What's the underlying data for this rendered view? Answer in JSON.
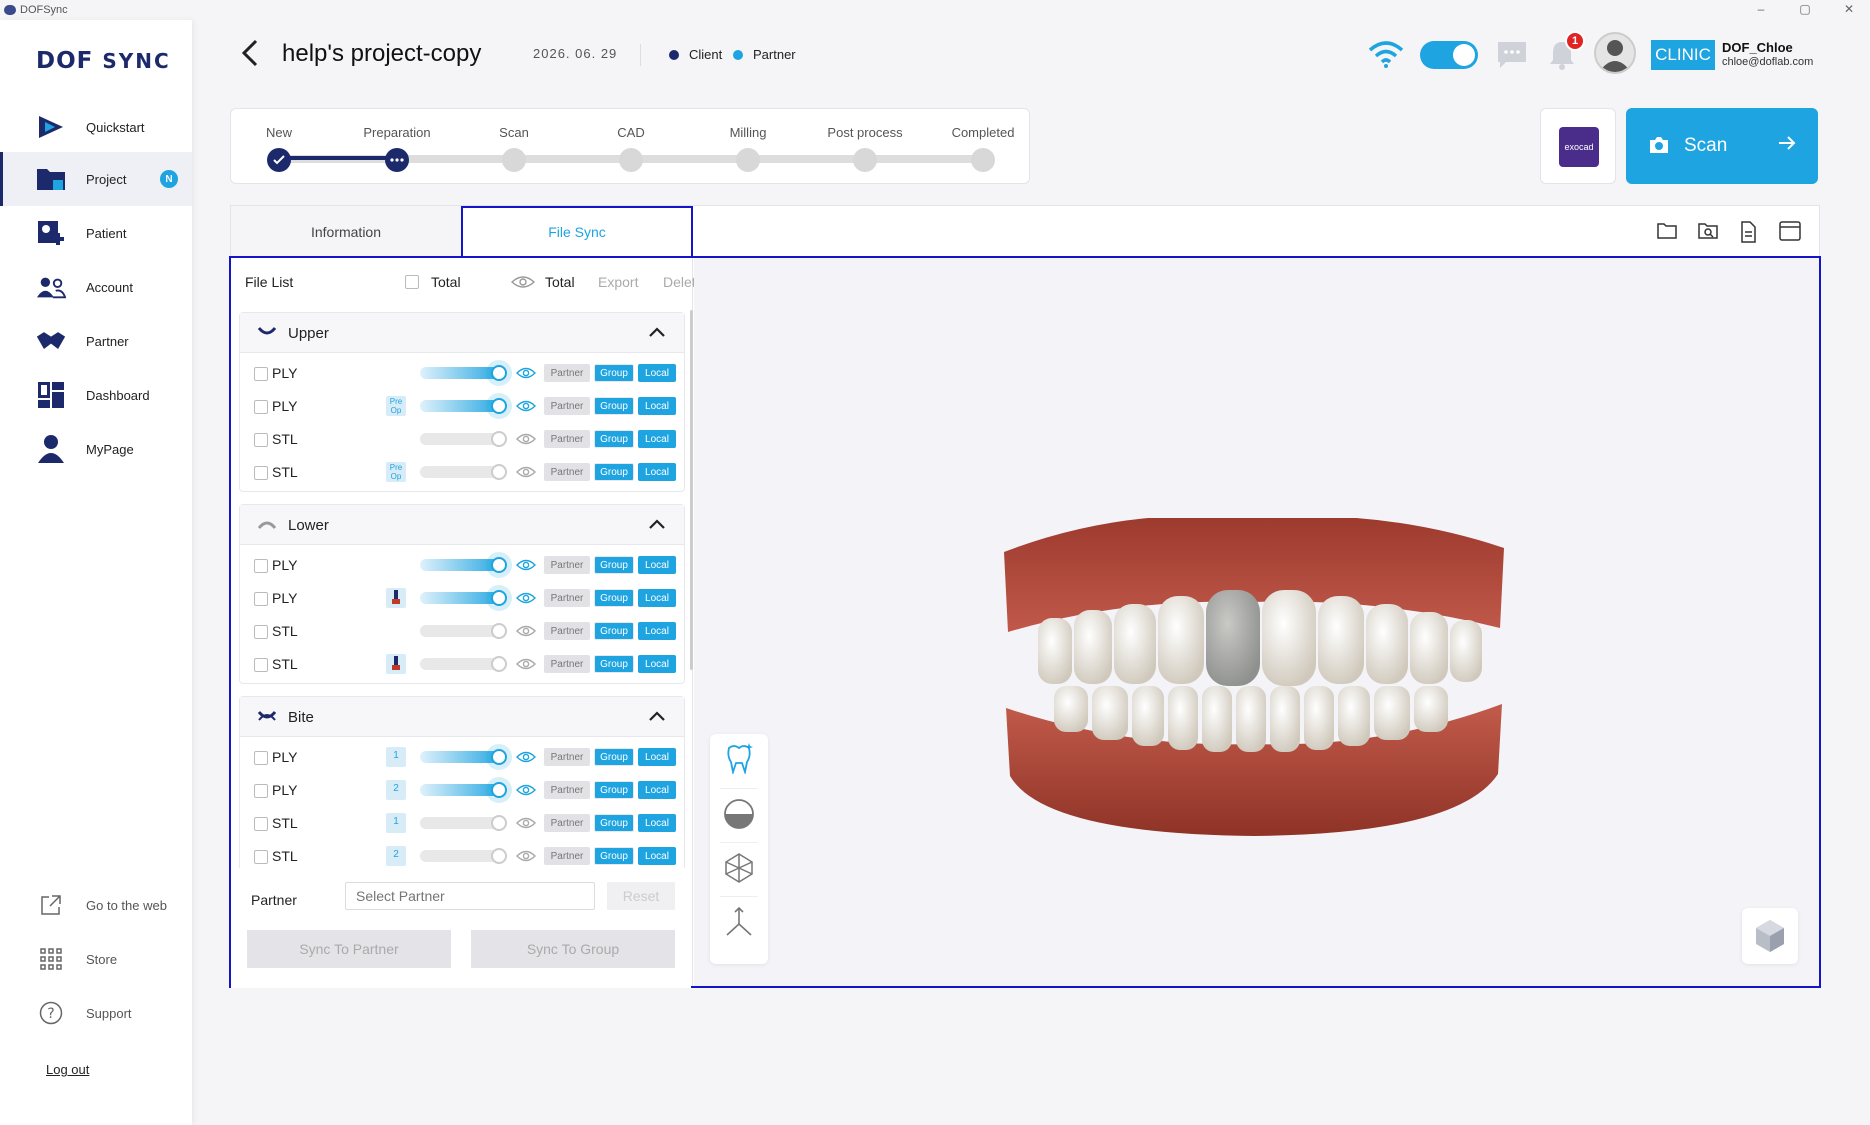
{
  "window": {
    "title": "DOFSync",
    "controls": [
      "–",
      "▢",
      "✕"
    ]
  },
  "sidebar": {
    "logo_a": "DOF",
    "logo_b": "SYNC",
    "items": [
      {
        "label": "Quickstart",
        "icon": "play-icon"
      },
      {
        "label": "Project",
        "icon": "folder-icon",
        "badge": "N",
        "active": true
      },
      {
        "label": "Patient",
        "icon": "patient-add-icon"
      },
      {
        "label": "Account",
        "icon": "users-icon"
      },
      {
        "label": "Partner",
        "icon": "handshake-icon"
      },
      {
        "label": "Dashboard",
        "icon": "dashboard-icon"
      },
      {
        "label": "MyPage",
        "icon": "person-icon"
      }
    ],
    "sub_items": [
      {
        "label": "Go to the web",
        "icon": "external-link-icon"
      },
      {
        "label": "Store",
        "icon": "grid-icon"
      },
      {
        "label": "Support",
        "icon": "help-icon"
      }
    ],
    "logout": "Log out"
  },
  "header": {
    "title": "help's project-copy",
    "date": "2026. 06. 29",
    "legend": [
      {
        "label": "Client",
        "color": "#1c2a6b"
      },
      {
        "label": "Partner",
        "color": "#1ea4e0"
      }
    ],
    "notification_count": "1",
    "clinic": "CLINIC",
    "user_name": "DOF_Chloe",
    "user_email": "chloe@doflab.com"
  },
  "stepper": {
    "steps": [
      "New",
      "Preparation",
      "Scan",
      "CAD",
      "Milling",
      "Post process",
      "Completed"
    ],
    "current": 1
  },
  "actions": {
    "exocad": "exocad",
    "scan": "Scan"
  },
  "tabs": {
    "information": "Information",
    "file_sync": "File Sync"
  },
  "file_list": {
    "title": "File List",
    "total_check": "Total",
    "total_view": "Total",
    "export": "Export",
    "delete": "Delete",
    "pill_partner": "Partner",
    "pill_group": "Group",
    "pill_local": "Local",
    "groups": [
      {
        "name": "Upper",
        "rows": [
          {
            "type": "PLY",
            "tag": "",
            "on": true
          },
          {
            "type": "PLY",
            "tag": "Pre Op",
            "on": true
          },
          {
            "type": "STL",
            "tag": "",
            "on": false
          },
          {
            "type": "STL",
            "tag": "Pre Op",
            "on": false
          }
        ]
      },
      {
        "name": "Lower",
        "rows": [
          {
            "type": "PLY",
            "tag": "",
            "on": true
          },
          {
            "type": "PLY",
            "tag": "tooth",
            "on": true
          },
          {
            "type": "STL",
            "tag": "",
            "on": false
          },
          {
            "type": "STL",
            "tag": "tooth",
            "on": false
          }
        ]
      },
      {
        "name": "Bite",
        "rows": [
          {
            "type": "PLY",
            "tag": "1",
            "on": true
          },
          {
            "type": "PLY",
            "tag": "2",
            "on": true
          },
          {
            "type": "STL",
            "tag": "1",
            "on": false
          },
          {
            "type": "STL",
            "tag": "2",
            "on": false
          }
        ]
      }
    ],
    "partner_label": "Partner",
    "partner_placeholder": "Select Partner",
    "reset": "Reset",
    "sync_partner": "Sync To Partner",
    "sync_group": "Sync To Group"
  },
  "colors": {
    "accent": "#1ea4e0",
    "brand": "#1c2a6b",
    "highlight_border": "#1414c8"
  }
}
